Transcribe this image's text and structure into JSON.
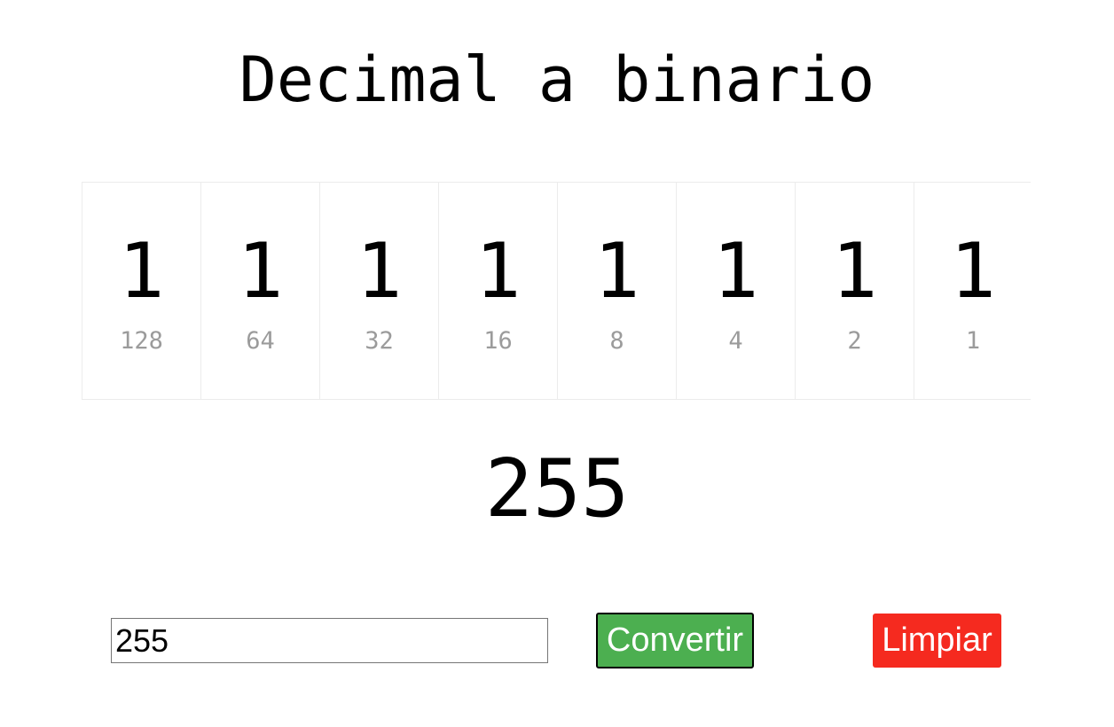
{
  "title": "Decimal a binario",
  "bits": [
    {
      "value": "1",
      "weight": "128"
    },
    {
      "value": "1",
      "weight": "64"
    },
    {
      "value": "1",
      "weight": "32"
    },
    {
      "value": "1",
      "weight": "16"
    },
    {
      "value": "1",
      "weight": "8"
    },
    {
      "value": "1",
      "weight": "4"
    },
    {
      "value": "1",
      "weight": "2"
    },
    {
      "value": "1",
      "weight": "1"
    }
  ],
  "result": "255",
  "input": {
    "value": "255",
    "placeholder": ""
  },
  "buttons": {
    "convert_label": "Convertir",
    "clear_label": "Limpiar"
  },
  "colors": {
    "convert_bg": "#4caf50",
    "clear_bg": "#f52a1f",
    "weight_text": "#9b9b9b"
  }
}
